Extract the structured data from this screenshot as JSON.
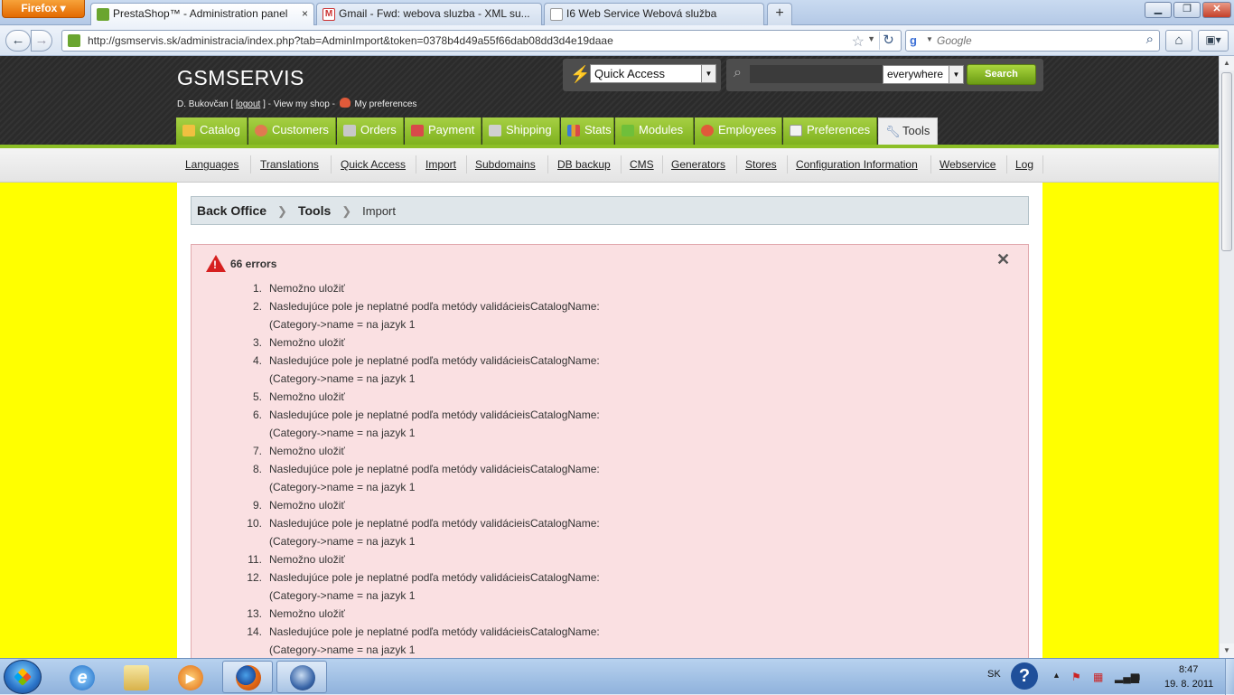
{
  "browser": {
    "menu_label": "Firefox",
    "tabs": [
      {
        "label": "PrestaShop™ - Administration panel",
        "close": "×"
      },
      {
        "label": "Gmail - Fwd: webova sluzba - XML su..."
      },
      {
        "label": "I6 Web Service Webová služba"
      }
    ],
    "new_tab": "+",
    "url": "http://gsmservis.sk/administracia/index.php?tab=AdminImport&token=0378b4d49a55f66dab08dd3d4e19daae",
    "search_placeholder": "Google"
  },
  "admin": {
    "shop_name": "GSMSERVIS",
    "user": {
      "name": "D. Bukovčan [",
      "logout": "logout",
      "after_logout": "] - View my shop -",
      "preferences": "My preferences"
    },
    "quick_access": "Quick Access",
    "search": {
      "value": "",
      "scope": "everywhere",
      "button": "Search"
    },
    "main_tabs": [
      "Catalog",
      "Customers",
      "Orders",
      "Payment",
      "Shipping",
      "Stats",
      "Modules",
      "Employees",
      "Preferences",
      "Tools"
    ],
    "active_tab": "Tools",
    "sub_menu": [
      "Languages",
      "Translations",
      "Quick Access",
      "Import",
      "Subdomains",
      "DB backup",
      "CMS",
      "Generators",
      "Stores",
      "Configuration Information",
      "Webservice",
      "Log"
    ],
    "breadcrumb": {
      "root": "Back Office",
      "section": "Tools",
      "current": "Import"
    },
    "errors": {
      "title": "66 errors",
      "items": [
        {
          "num": "1.",
          "line1": "Nemožno uložiť",
          "line2": ""
        },
        {
          "num": "2.",
          "line1": "Nasledujúce pole je neplatné podľa metódy validácieisCatalogName:",
          "line2": "(Category->name = na jazyk 1"
        },
        {
          "num": "3.",
          "line1": "Nemožno uložiť",
          "line2": ""
        },
        {
          "num": "4.",
          "line1": "Nasledujúce pole je neplatné podľa metódy validácieisCatalogName:",
          "line2": "(Category->name = na jazyk 1"
        },
        {
          "num": "5.",
          "line1": "Nemožno uložiť",
          "line2": ""
        },
        {
          "num": "6.",
          "line1": "Nasledujúce pole je neplatné podľa metódy validácieisCatalogName:",
          "line2": "(Category->name = na jazyk 1"
        },
        {
          "num": "7.",
          "line1": "Nemožno uložiť",
          "line2": ""
        },
        {
          "num": "8.",
          "line1": "Nasledujúce pole je neplatné podľa metódy validácieisCatalogName:",
          "line2": "(Category->name = na jazyk 1"
        },
        {
          "num": "9.",
          "line1": "Nemožno uložiť",
          "line2": ""
        },
        {
          "num": "10.",
          "line1": "Nasledujúce pole je neplatné podľa metódy validácieisCatalogName:",
          "line2": "(Category->name = na jazyk 1"
        },
        {
          "num": "11.",
          "line1": "Nemožno uložiť",
          "line2": ""
        },
        {
          "num": "12.",
          "line1": "Nasledujúce pole je neplatné podľa metódy validácieisCatalogName:",
          "line2": "(Category->name = na jazyk 1"
        },
        {
          "num": "13.",
          "line1": "Nemožno uložiť",
          "line2": ""
        },
        {
          "num": "14.",
          "line1": "Nasledujúce pole je neplatné podľa metódy validácieisCatalogName:",
          "line2": "(Category->name = na jazyk 1"
        }
      ]
    }
  },
  "taskbar": {
    "language": "SK",
    "help": "?",
    "time": "8:47",
    "date": "19. 8. 2011"
  },
  "colors": {
    "accent_green": "#8cbf26",
    "page_background": "#ffff00",
    "error_background": "#fae0e2",
    "header_dark": "#2e2e2e"
  }
}
